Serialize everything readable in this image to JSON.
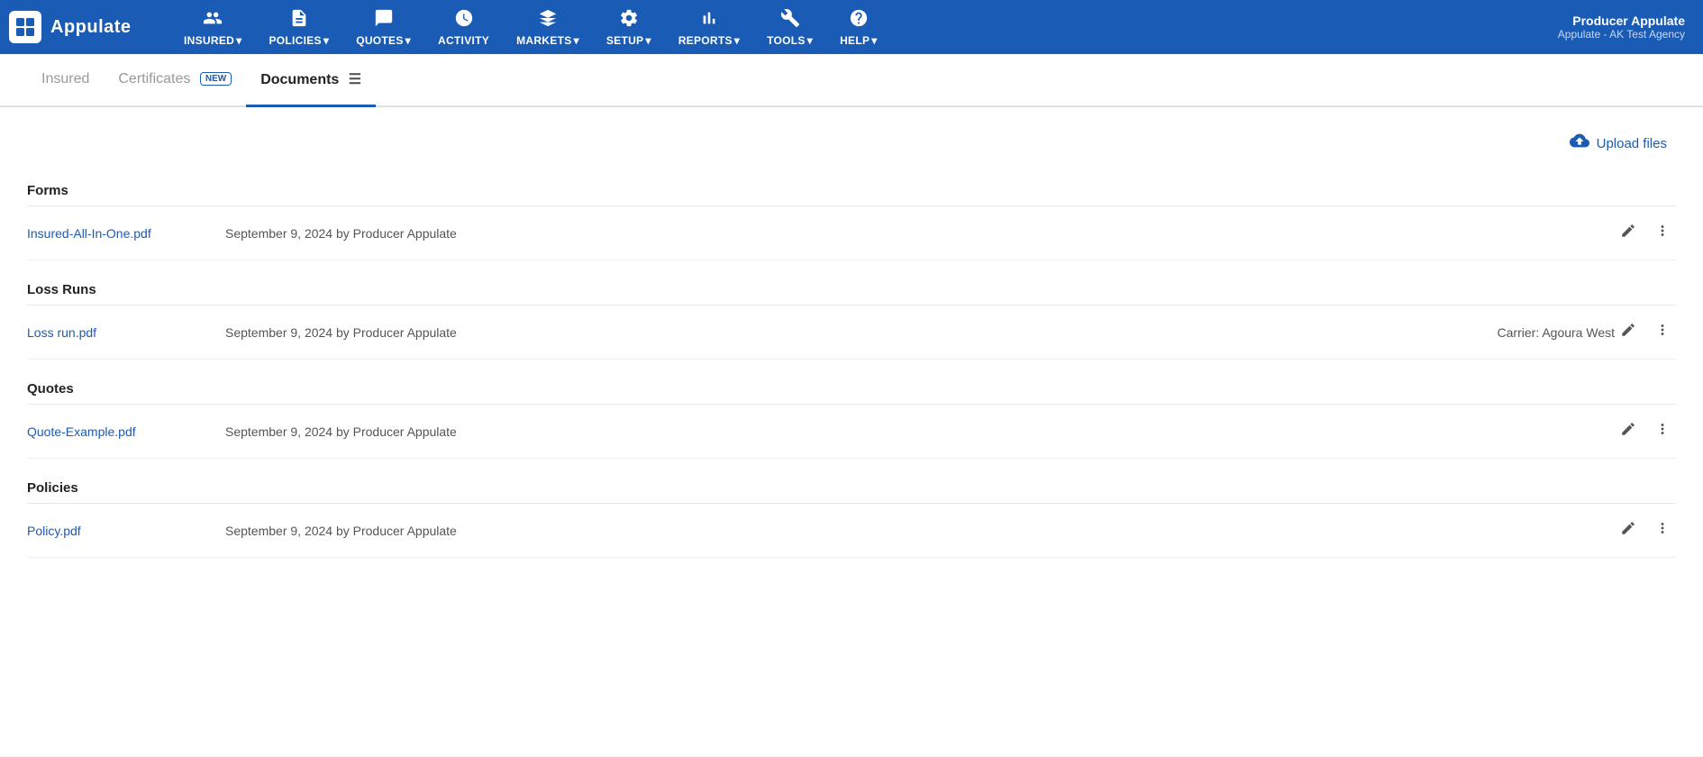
{
  "app": {
    "name": "Appulate"
  },
  "navbar": {
    "brand": "Appulate",
    "user_name": "Producer Appulate",
    "user_agency": "Appulate - AK Test Agency",
    "items": [
      {
        "id": "insured",
        "icon": "👤",
        "label": "INSURED",
        "has_dropdown": true
      },
      {
        "id": "policies",
        "icon": "📄",
        "label": "POLICIES",
        "has_dropdown": true
      },
      {
        "id": "quotes",
        "icon": "📋",
        "label": "QUOTES",
        "has_dropdown": true
      },
      {
        "id": "activity",
        "icon": "⏰",
        "label": "ACTIVITY",
        "has_dropdown": false
      },
      {
        "id": "markets",
        "icon": "🏛",
        "label": "MARKETS",
        "has_dropdown": true
      },
      {
        "id": "setup",
        "icon": "⚙️",
        "label": "SETUP",
        "has_dropdown": true
      },
      {
        "id": "reports",
        "icon": "📊",
        "label": "REPORTS",
        "has_dropdown": true
      },
      {
        "id": "tools",
        "icon": "🔧",
        "label": "TOOLS",
        "has_dropdown": true
      },
      {
        "id": "help",
        "icon": "❓",
        "label": "HELP",
        "has_dropdown": true
      }
    ]
  },
  "tabs": [
    {
      "id": "insured",
      "label": "Insured",
      "active": false,
      "badge": null
    },
    {
      "id": "certificates",
      "label": "Certificates",
      "active": false,
      "badge": "NEW"
    },
    {
      "id": "documents",
      "label": "Documents",
      "active": true,
      "badge": null
    }
  ],
  "upload_button_label": "Upload files",
  "sections": [
    {
      "id": "forms",
      "title": "Forms",
      "documents": [
        {
          "id": "doc1",
          "name": "Insured-All-In-One.pdf",
          "meta": "September 9, 2024 by Producer Appulate",
          "carrier": null
        }
      ]
    },
    {
      "id": "loss-runs",
      "title": "Loss Runs",
      "documents": [
        {
          "id": "doc2",
          "name": "Loss run.pdf",
          "meta": "September 9, 2024 by Producer Appulate",
          "carrier": "Carrier: Agoura West"
        }
      ]
    },
    {
      "id": "quotes",
      "title": "Quotes",
      "documents": [
        {
          "id": "doc3",
          "name": "Quote-Example.pdf",
          "meta": "September 9, 2024 by Producer Appulate",
          "carrier": null
        }
      ]
    },
    {
      "id": "policies",
      "title": "Policies",
      "documents": [
        {
          "id": "doc4",
          "name": "Policy.pdf",
          "meta": "September 9, 2024 by Producer Appulate",
          "carrier": null
        }
      ]
    }
  ],
  "colors": {
    "primary": "#1a5bb5",
    "text_dark": "#222",
    "text_muted": "#555"
  }
}
